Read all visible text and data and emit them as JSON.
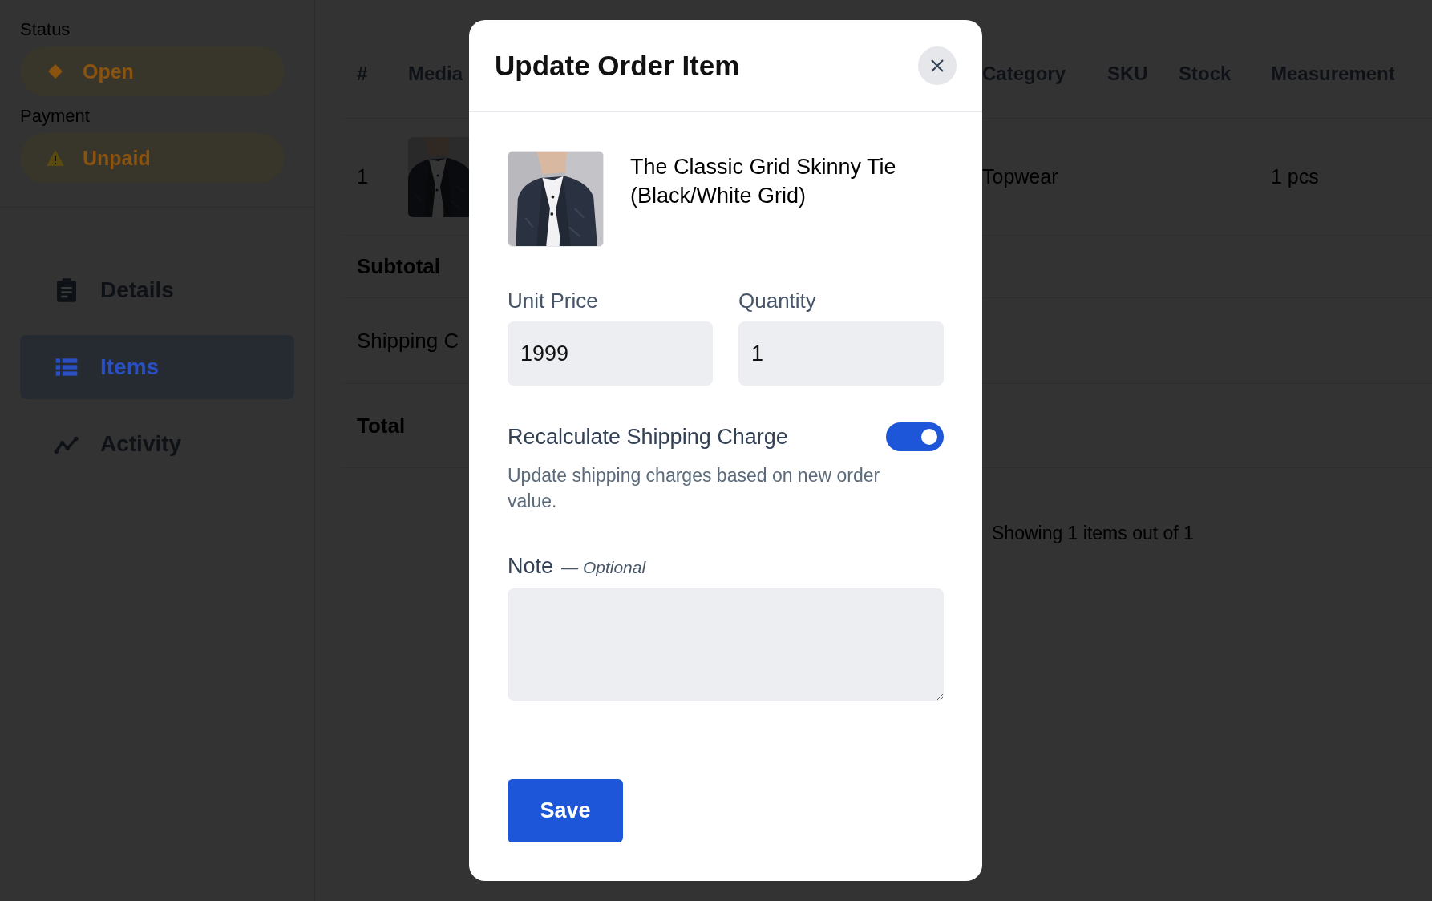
{
  "sidebar": {
    "status": {
      "label": "Status",
      "value": "Open"
    },
    "payment": {
      "label": "Payment",
      "value": "Unpaid"
    },
    "nav": [
      {
        "label": "Details",
        "selected": false
      },
      {
        "label": "Items",
        "selected": true
      },
      {
        "label": "Activity",
        "selected": false
      }
    ]
  },
  "table": {
    "columns": [
      "#",
      "Media",
      "Category",
      "SKU",
      "Stock",
      "Measurement"
    ],
    "rows": [
      {
        "number": "1",
        "category": "Topwear",
        "measurement": "1 pcs"
      }
    ],
    "summary_rows": [
      "Subtotal",
      "Shipping C",
      "Total"
    ],
    "footer": "Showing 1 items out of 1"
  },
  "modal": {
    "title": "Update Order Item",
    "product": {
      "name": "The Classic Grid Skinny Tie (Black/White Grid)"
    },
    "fields": [
      {
        "label": "Unit Price",
        "value": "1999"
      },
      {
        "label": "Quantity",
        "value": "1"
      }
    ],
    "shipping_toggle": {
      "label": "Recalculate Shipping Charge",
      "on": true,
      "description": "Update shipping charges based on new order value."
    },
    "note": {
      "label": "Note",
      "hint": "— Optional"
    },
    "save_button": "Save"
  }
}
